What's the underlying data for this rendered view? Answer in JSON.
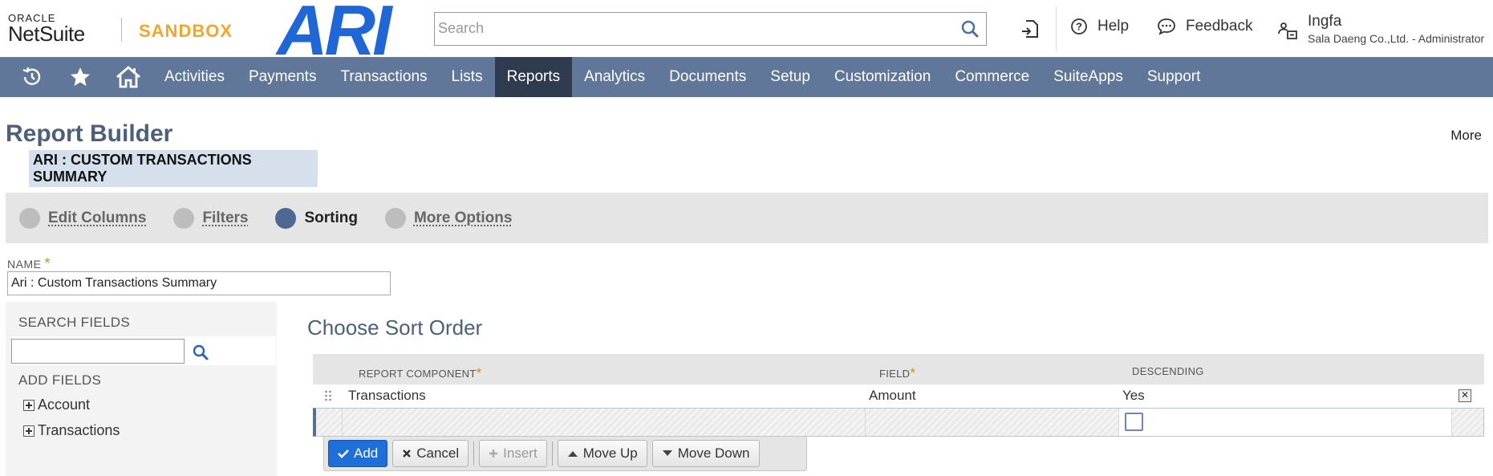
{
  "header": {
    "oracle_label": "ORACLE",
    "netsuite_label": "NetSuite",
    "sandbox_label": "SANDBOX",
    "ari_logo_text": "ARI",
    "search_placeholder": "Search",
    "help_label": "Help",
    "feedback_label": "Feedback",
    "user_name": "Ingfa",
    "user_role": "Sala Daeng Co.,Ltd. - Administrator"
  },
  "nav": {
    "items": [
      "Activities",
      "Payments",
      "Transactions",
      "Lists",
      "Reports",
      "Analytics",
      "Documents",
      "Setup",
      "Customization",
      "Commerce",
      "SuiteApps",
      "Support"
    ],
    "active": "Reports"
  },
  "page": {
    "title": "Report Builder",
    "more_label": "More",
    "report_name_badge": "ARI : CUSTOM TRANSACTIONS SUMMARY"
  },
  "steps": [
    {
      "label": "Edit Columns",
      "active": false
    },
    {
      "label": "Filters",
      "active": false
    },
    {
      "label": "Sorting",
      "active": true
    },
    {
      "label": "More Options",
      "active": false
    }
  ],
  "name_field": {
    "label": "NAME",
    "required_mark": "*",
    "value": "Ari : Custom Transactions Summary"
  },
  "left_panel": {
    "search_fields_label": "SEARCH FIELDS",
    "add_fields_label": "ADD FIELDS",
    "tree": [
      "Account",
      "Transactions"
    ]
  },
  "sort": {
    "title": "Choose Sort Order",
    "columns": {
      "component": "REPORT COMPONENT",
      "field": "FIELD",
      "descending": "DESCENDING",
      "required_mark": "*"
    },
    "rows": [
      {
        "component": "Transactions",
        "field": "Amount",
        "descending": "Yes",
        "remove_glyph": "✕"
      }
    ],
    "buttons": {
      "add": "Add",
      "cancel": "Cancel",
      "insert": "Insert",
      "move_up": "Move Up",
      "move_down": "Move Down"
    }
  }
}
